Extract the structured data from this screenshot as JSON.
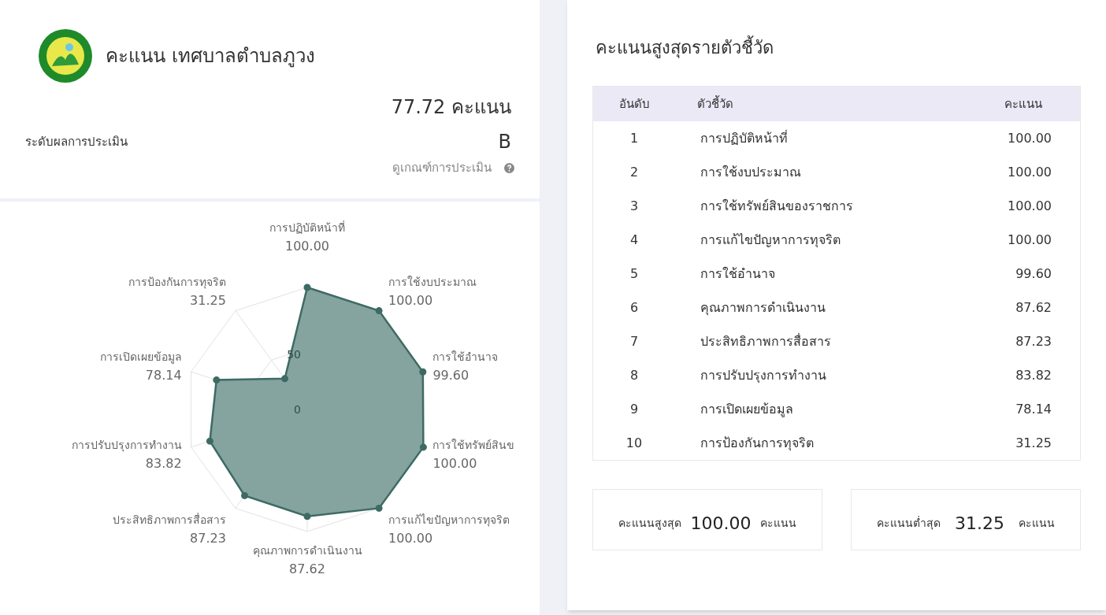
{
  "profile": {
    "title": "คะแนน เทศบาลตำบลภูวง",
    "score": "77.72 คะแนน",
    "grade_label": "ระดับผลการประเมิน",
    "grade": "B",
    "criteria_link": "ดูเกณฑ์การประเมิน"
  },
  "radar_chart": {
    "scale_labels": [
      "50",
      "0"
    ],
    "right_axes": [
      {
        "label": "การปฏิบัติหน้าที่",
        "value": "100.00"
      },
      {
        "label": "การใช้งบประมาณ",
        "value": "100.00"
      },
      {
        "label": "การใช้อำนาจ",
        "value": "99.60"
      },
      {
        "label": "การใช้ทรัพย์สินข",
        "value": "100.00"
      },
      {
        "label": "การแก้ไขปัญหาการทุจริต",
        "value": "100.00"
      },
      {
        "label": "คุณภาพการดำเนินงาน",
        "value": "87.62"
      }
    ],
    "left_axes": [
      {
        "label": "การป้องกันการทุจริต",
        "value": "31.25"
      },
      {
        "label": "การเปิดเผยข้อมูล",
        "value": "78.14"
      },
      {
        "label": "การปรับปรุงการทำงาน",
        "value": "83.82"
      },
      {
        "label": "ประสิทธิภาพการสื่อสาร",
        "value": "87.23"
      }
    ]
  },
  "ranking": {
    "title": "คะแนนสูงสุดรายตัวชี้วัด",
    "columns": [
      "อันดับ",
      "ตัวชี้วัด",
      "คะแนน"
    ],
    "rows": [
      {
        "rank": "1",
        "indicator": "การปฏิบัติหน้าที่",
        "score": "100.00"
      },
      {
        "rank": "2",
        "indicator": "การใช้งบประมาณ",
        "score": "100.00"
      },
      {
        "rank": "3",
        "indicator": "การใช้ทรัพย์สินของราชการ",
        "score": "100.00"
      },
      {
        "rank": "4",
        "indicator": "การแก้ไขปัญหาการทุจริต",
        "score": "100.00"
      },
      {
        "rank": "5",
        "indicator": "การใช้อำนาจ",
        "score": "99.60"
      },
      {
        "rank": "6",
        "indicator": "คุณภาพการดำเนินงาน",
        "score": "87.62"
      },
      {
        "rank": "7",
        "indicator": "ประสิทธิภาพการสื่อสาร",
        "score": "87.23"
      },
      {
        "rank": "8",
        "indicator": "การปรับปรุงการทำงาน",
        "score": "83.82"
      },
      {
        "rank": "9",
        "indicator": "การเปิดเผยข้อมูล",
        "score": "78.14"
      },
      {
        "rank": "10",
        "indicator": "การป้องกันการทุจริต",
        "score": "31.25"
      }
    ]
  },
  "summary": [
    {
      "label": "คะแนนสูงสุด",
      "value": "100.00",
      "unit": "คะแนน"
    },
    {
      "label": "คะแนนต่ำสุด",
      "value": "31.25",
      "unit": "คะแนน"
    }
  ]
}
